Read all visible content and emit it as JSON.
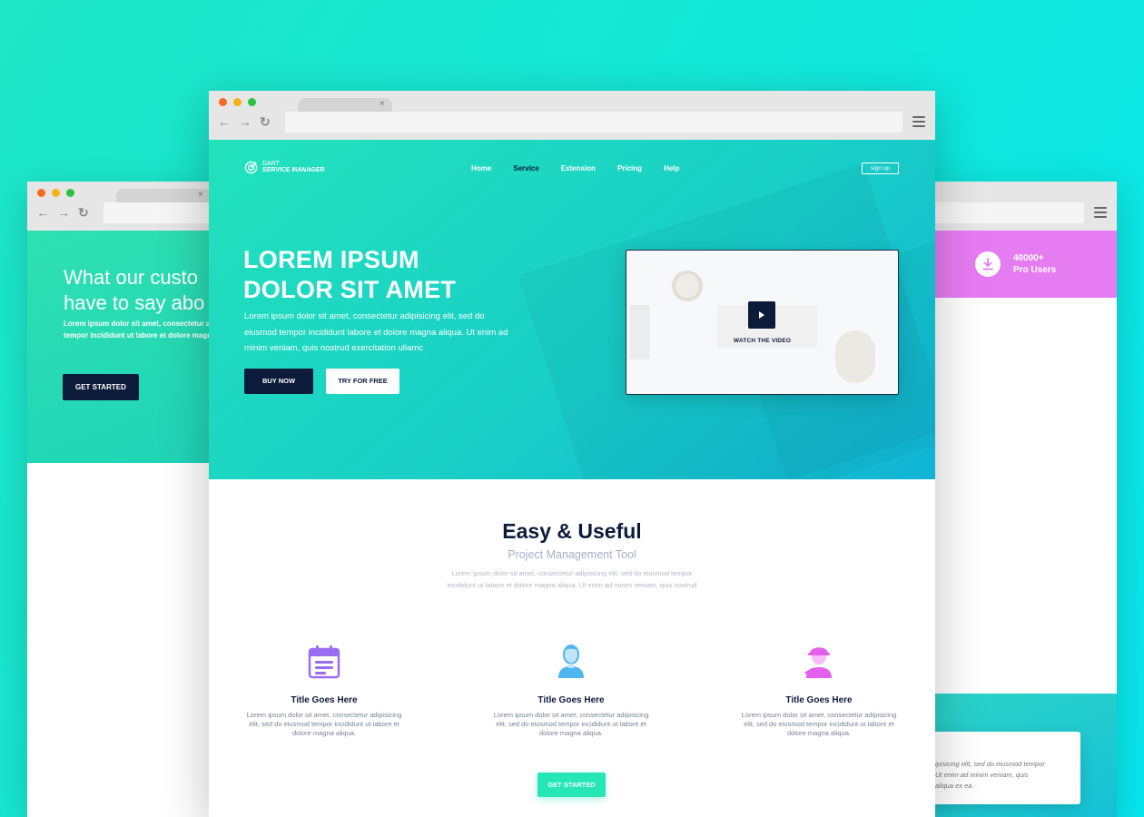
{
  "left_window": {
    "heading_line1": "What our custo",
    "heading_line2": "have to say abo",
    "text_line1": "Lorem ipsum dolor sit amet, consectetur adip",
    "text_line2": "tempor incididunt ut labore et dolore magna",
    "cta_label": "GET STARTED",
    "tab_close": "×"
  },
  "right_window": {
    "stat_count": "40000+",
    "stat_label": "Pro Users",
    "testimonial_line1": "ipisicing elit, sed do eiusmod tempor",
    "testimonial_line2": "Ut enim ad minim veniam, quis",
    "testimonial_line3": "aliqua ex ea"
  },
  "main_window": {
    "tab_close": "×",
    "logo": {
      "line1": "DART",
      "line2": "SERVICE MANAGER"
    },
    "nav": [
      {
        "label": "Home",
        "active": false
      },
      {
        "label": "Service",
        "active": true
      },
      {
        "label": "Extension",
        "active": false
      },
      {
        "label": "Pricing",
        "active": false
      },
      {
        "label": "Help",
        "active": false
      }
    ],
    "signup_label": "sign up",
    "hero": {
      "title_line1": "LOREM IPSUM",
      "title_line2": "DOLOR SIT AMET",
      "text": "Lorem ipsum dolor sit amet, consectetur adipisicing elit, sed do eiusmod tempor incididunt labore et dolore magna aliqua. Ut enim ad minim veniam, quis nostrud exercitation ullamc",
      "buy_label": "BUY NOW",
      "try_label": "TRY FOR FREE",
      "video_label": "WATCH THE VIDEO"
    },
    "section": {
      "title": "Easy & Useful",
      "subtitle": "Project Management Tool",
      "text": "Lorem ipsum dolor sit amet, consectetur adipisicing elit, sed do eiusmod tempor incididunt ut labore et dolore magna aliqua. Ut enim ad minim veniam, quis nostrud"
    },
    "features": [
      {
        "icon": "calendar-icon",
        "title": "Title Goes Here",
        "text": "Lorem ipsum dolor sit amet, consectetur adipisicing elit, sed do eiusmod tempor incididunt ut labore et dolore magna aliqua."
      },
      {
        "icon": "user-icon",
        "title": "Title Goes Here",
        "text": "Lorem ipsum dolor sit amet, consectetur adipisicing elit, sed do eiusmod tempor incididunt ut labore et dolore magna aliqua."
      },
      {
        "icon": "worker-icon",
        "title": "Title Goes Here",
        "text": "Lorem ipsum dolor sit amet, consectetur adipisicing elit, sed do eiusmod tempor incididunt ut labore et dolore magna aliqua."
      }
    ],
    "cta_label": "GET STARTED"
  },
  "colors": {
    "navy": "#0d1b3a",
    "accent_green": "#25e6b4",
    "pink_band": "#e67cf2",
    "purple_icon": "#9b6cf2",
    "blue_icon": "#4fb6ef"
  }
}
